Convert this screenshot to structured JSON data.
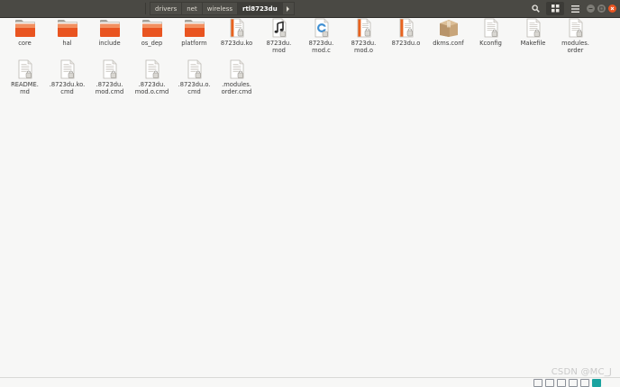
{
  "pathbar": {
    "crumbs": [
      "drivers",
      "net",
      "wireless",
      "rtl8723du"
    ]
  },
  "files": [
    {
      "label": "core",
      "kind": "folder"
    },
    {
      "label": "hal",
      "kind": "folder"
    },
    {
      "label": "include",
      "kind": "folder"
    },
    {
      "label": "os_dep",
      "kind": "folder"
    },
    {
      "label": "platform",
      "kind": "folder"
    },
    {
      "label": "8723du.ko",
      "kind": "binary"
    },
    {
      "label": "8723du.\nmod",
      "kind": "audio"
    },
    {
      "label": "8723du.\nmod.c",
      "kind": "csource"
    },
    {
      "label": "8723du.\nmod.o",
      "kind": "binary"
    },
    {
      "label": "8723du.o",
      "kind": "binary"
    },
    {
      "label": "dkms.conf",
      "kind": "package"
    },
    {
      "label": "Kconfig",
      "kind": "text"
    },
    {
      "label": "Makefile",
      "kind": "text"
    },
    {
      "label": "modules.\norder",
      "kind": "text"
    },
    {
      "label": "README.\nmd",
      "kind": "text"
    },
    {
      "label": ".8723du.ko.\ncmd",
      "kind": "textlocked"
    },
    {
      "label": ".8723du.\nmod.cmd",
      "kind": "textlocked"
    },
    {
      "label": ".8723du.\nmod.o.cmd",
      "kind": "textlocked"
    },
    {
      "label": ".8723du.o.\ncmd",
      "kind": "textlocked"
    },
    {
      "label": ".modules.\norder.cmd",
      "kind": "textlocked"
    }
  ],
  "watermark": "CSDN @MC_J",
  "colors": {
    "headerbar": "#4a4944",
    "folder_orange": "#e95420",
    "folder_light": "#f39b6c"
  }
}
